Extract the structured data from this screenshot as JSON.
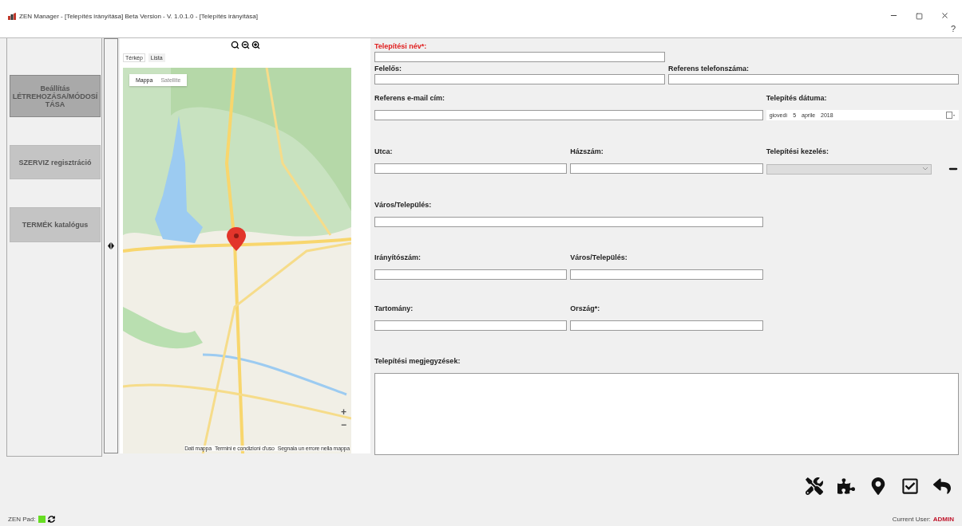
{
  "window": {
    "title": "ZEN Manager - [Telepítés irányítása] Beta Version - V. 1.0.1.0 - [Telepítés irányítása]",
    "help": "?"
  },
  "sidebar": {
    "items": [
      {
        "label": "Beállítás LÉTREHOZÁSA/MÓDOSÍTÁSA",
        "selected": true
      },
      {
        "label": "SZERVIZ regisztráció",
        "selected": false
      },
      {
        "label": "TERMÉK katalógus",
        "selected": false
      }
    ]
  },
  "map_panel": {
    "tabs": [
      {
        "label": "Térkép",
        "selected": true
      },
      {
        "label": "Lista",
        "selected": false
      }
    ],
    "map_types": [
      {
        "label": "Mappa",
        "selected": true
      },
      {
        "label": "Satellite",
        "selected": false
      }
    ],
    "zoom_controls": [
      "+",
      "−"
    ],
    "attribution": [
      "Dati mappa",
      "Termini e condizioni d'uso",
      "Segnala un errore nella mappa"
    ]
  },
  "form": {
    "fields": [
      {
        "kind": "text",
        "label": "Telepítési név*:",
        "error": true
      },
      {
        "kind": "text",
        "label": "Felelős:",
        "error": false
      },
      {
        "kind": "text",
        "label": "Referens telefonszáma:",
        "error": false
      },
      {
        "kind": "text",
        "label": "Referens e-mail cím:",
        "error": false
      },
      {
        "kind": "date",
        "label": "Telepítés dátuma:",
        "value": "giovedì 5 aprile 2018",
        "error": false
      },
      {
        "kind": "text",
        "label": "Utca:",
        "error": false
      },
      {
        "kind": "text",
        "label": "Házszám:",
        "error": false
      },
      {
        "kind": "select",
        "label": "Telepítési kezelés:",
        "disabled": true,
        "error": false
      },
      {
        "kind": "text",
        "label": "Város/Település:",
        "error": false
      },
      {
        "kind": "text",
        "label": "Irányítószám:",
        "error": false
      },
      {
        "kind": "text",
        "label": "Város/Település:",
        "error": false
      },
      {
        "kind": "text",
        "label": "Tartomány:",
        "error": false
      },
      {
        "kind": "text",
        "label": "Ország*:",
        "error": false
      },
      {
        "kind": "textarea",
        "label": "Telepítési megjegyzések:",
        "error": false
      }
    ]
  },
  "status_bar": {
    "pad_label": "ZEN Pad:",
    "pad_online": true,
    "user_label": "Current User:",
    "user": "ADMIN"
  }
}
